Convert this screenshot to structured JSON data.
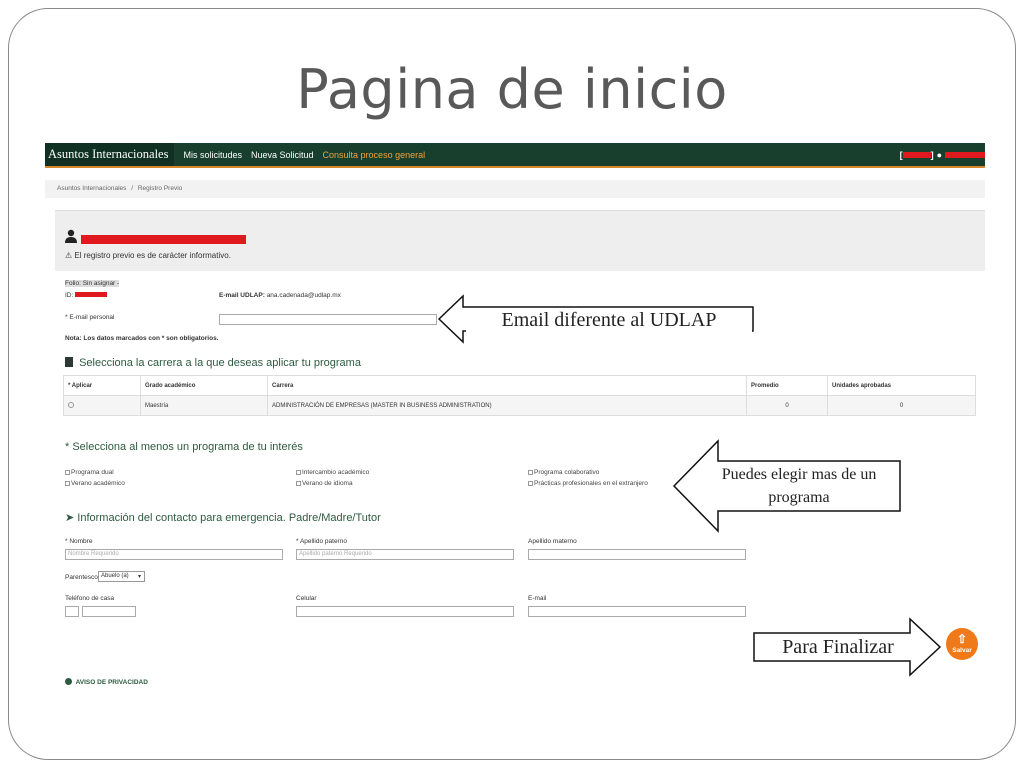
{
  "slide": {
    "title": "Pagina de inicio"
  },
  "navbar": {
    "brand": "Asuntos Internacionales",
    "links": [
      "Mis solicitudes",
      "Nueva Solicitud",
      "Consulta proceso general"
    ],
    "user_id_prefix": "[",
    "user_id_suffix": "]"
  },
  "breadcrumb": {
    "items": [
      "Asuntos Internacionales",
      "/",
      "Registro Previo"
    ]
  },
  "panel": {
    "info": "El registro previo es de carácter informativo."
  },
  "form": {
    "folio": "Folio: Sin asignar -",
    "id_label": "ID:",
    "email_udlap_label": "E-mail UDLAP:",
    "email_udlap_value": "ana.cadenada@udlap.mx",
    "email_personal_label": "* E-mail personal",
    "required_note": "Nota: Los datos marcados con * son obligatorios."
  },
  "careers": {
    "title": "Selecciona la carrera a la que deseas aplicar tu programa",
    "headers": [
      "* Aplicar",
      "Grado académico",
      "Carrera",
      "Promedio",
      "Unidades aprobadas"
    ],
    "rows": [
      [
        "",
        "Maestría",
        "ADMINISTRACIÓN DE EMPRESAS (MASTER IN BUSINESS ADMINISTRATION)",
        "0",
        "0"
      ]
    ]
  },
  "programs": {
    "title": "* Selecciona al menos un programa de tu interés",
    "options": [
      "Programa dual",
      "Verano académico",
      "Intercambio académico",
      "Verano de idioma",
      "Programa colaborativo",
      "Prácticas profesionales en el extranjero"
    ]
  },
  "emergency": {
    "title": "Información del contacto para emergencia. Padre/Madre/Tutor",
    "nombre_label": "* Nombre",
    "nombre_placeholder": "Nombre Requerido",
    "apellido_paterno_label": "* Apellido paterno",
    "apellido_paterno_placeholder": "Apellido paterno Requerido",
    "apellido_materno_label": "Apellido materno",
    "parentesco_label": "Parentesco",
    "parentesco_value": "Abuelo (a)",
    "telefono_label": "Teléfono de casa",
    "celular_label": "Celular",
    "email_label": "E-mail"
  },
  "privacy": {
    "label": "AVISO DE PRIVACIDAD"
  },
  "save": {
    "label": "Salvar"
  },
  "callouts": {
    "email": "Email diferente al UDLAP",
    "programs": "Puedes elegir mas de un programa",
    "finish": "Para Finalizar"
  },
  "colors": {
    "navbar": "#183f2e",
    "accent": "#d7882a",
    "save": "#f07a1a",
    "redaction": "#e0191f"
  }
}
